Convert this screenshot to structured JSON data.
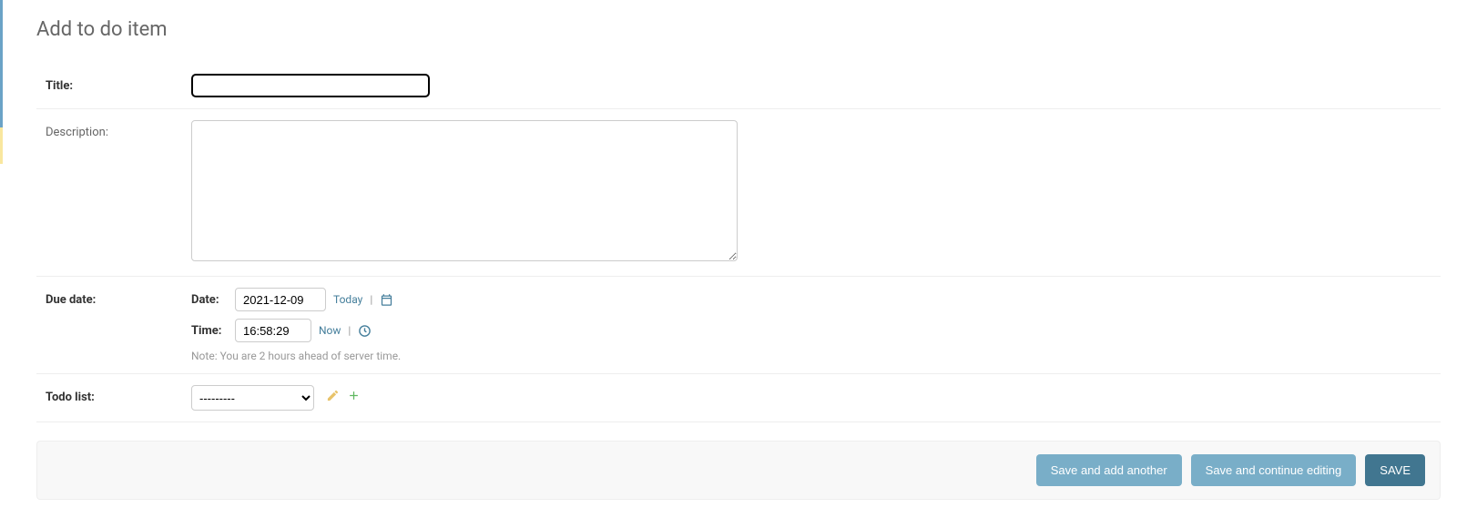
{
  "page": {
    "title": "Add to do item"
  },
  "fields": {
    "title": {
      "label": "Title:",
      "value": ""
    },
    "description": {
      "label": "Description:",
      "value": ""
    },
    "due_date": {
      "label": "Due date:",
      "date_label": "Date:",
      "date_value": "2021-12-09",
      "today_link": "Today",
      "time_label": "Time:",
      "time_value": "16:58:29",
      "now_link": "Now",
      "note": "Note: You are 2 hours ahead of server time."
    },
    "todo_list": {
      "label": "Todo list:",
      "selected": "---------"
    }
  },
  "actions": {
    "save_add_another": "Save and add another",
    "save_continue": "Save and continue editing",
    "save": "SAVE"
  }
}
